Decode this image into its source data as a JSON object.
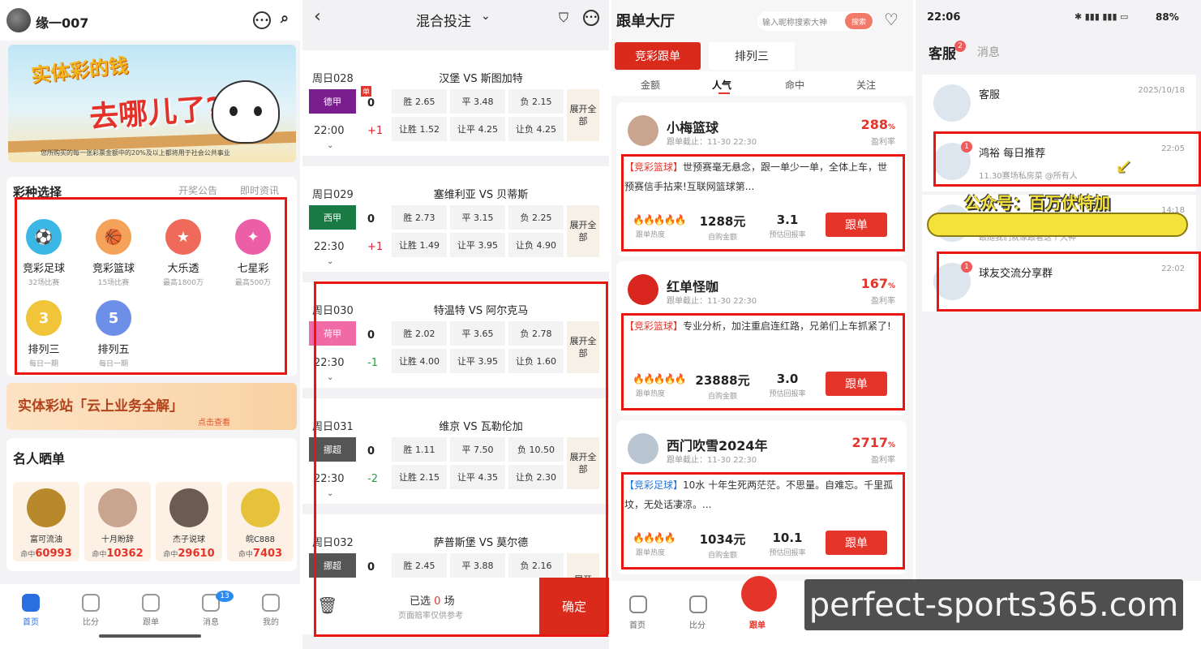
{
  "panel1": {
    "username": "缘一007",
    "banner": {
      "line1": "实体彩的钱",
      "line2": "去哪儿了?",
      "footnote": "您所购买的每一张彩票金额中的20%及以上都将用于社会公共事业"
    },
    "section_title": "彩种选择",
    "section_links": [
      "开奖公告",
      "即时资讯"
    ],
    "lotteries": [
      {
        "name": "竞彩足球",
        "sub": "32场比赛",
        "color": "#3bb7e6",
        "glyph": "⚽"
      },
      {
        "name": "竞彩篮球",
        "sub": "15场比赛",
        "color": "#f5a25a",
        "glyph": "🏀"
      },
      {
        "name": "大乐透",
        "sub": "最高1800万",
        "color": "#ef6a5a",
        "glyph": "★"
      },
      {
        "name": "七星彩",
        "sub": "最高500万",
        "color": "#ec5ea8",
        "glyph": "✦"
      },
      {
        "name": "排列三",
        "sub": "每日一期",
        "color": "#f1c43a",
        "glyph": "3"
      },
      {
        "name": "排列五",
        "sub": "每日一期",
        "color": "#6e8fe8",
        "glyph": "5"
      }
    ],
    "promo_title": "实体彩站「云上业务全解」",
    "promo_link": "点击查看",
    "celebs_title": "名人晒单",
    "celebs": [
      {
        "name": "富可流油",
        "hits_label": "命中",
        "hits": "60993",
        "color": "#b8892a"
      },
      {
        "name": "十月盼辞",
        "hits_label": "命中",
        "hits": "10362",
        "color": "#c9a48f"
      },
      {
        "name": "杰子说球",
        "hits_label": "命中",
        "hits": "29610",
        "color": "#6b5b52"
      },
      {
        "name": "皖C888",
        "hits_label": "命中",
        "hits": "7403",
        "color": "#e5c23a"
      }
    ],
    "tabs": [
      {
        "label": "首页",
        "active": true
      },
      {
        "label": "比分",
        "active": false
      },
      {
        "label": "跟单",
        "active": false
      },
      {
        "label": "消息",
        "active": false,
        "badge": "13"
      },
      {
        "label": "我的",
        "active": false
      }
    ]
  },
  "panel2": {
    "title": "混合投注",
    "matches": [
      {
        "day": "周日028",
        "home": "汉堡",
        "vs": "VS",
        "away": "斯图加特",
        "league": "德甲",
        "league_color": "#7a1d8e",
        "time": "22:00",
        "hc0": "0",
        "hc1": "+1",
        "row1": [
          "胜 2.65",
          "平 3.48",
          "负 2.15"
        ],
        "row2": [
          "让胜 1.52",
          "让平 4.25",
          "让负 4.25"
        ],
        "expand": "展开全部",
        "single": "单"
      },
      {
        "day": "周日029",
        "home": "塞维利亚",
        "vs": "VS",
        "away": "贝蒂斯",
        "league": "西甲",
        "league_color": "#1a7a44",
        "time": "22:30",
        "hc0": "0",
        "hc1": "+1",
        "row1": [
          "胜 2.73",
          "平 3.15",
          "负 2.25"
        ],
        "row2": [
          "让胜 1.49",
          "让平 3.95",
          "让负 4.90"
        ],
        "expand": "展开全部"
      },
      {
        "day": "周日030",
        "home": "特温特",
        "vs": "VS",
        "away": "阿尔克马",
        "league": "荷甲",
        "league_color": "#f06aa6",
        "time": "22:30",
        "hc0": "0",
        "hc1": "-1",
        "row1": [
          "胜 2.02",
          "平 3.65",
          "负 2.78"
        ],
        "row2": [
          "让胜 4.00",
          "让平 3.95",
          "让负 1.60"
        ],
        "expand": "展开全部"
      },
      {
        "day": "周日031",
        "home": "维京",
        "vs": "VS",
        "away": "瓦勒伦加",
        "league": "挪超",
        "league_color": "#555555",
        "time": "22:30",
        "hc0": "0",
        "hc1": "-2",
        "row1": [
          "胜 1.11",
          "平 7.50",
          "负 10.50"
        ],
        "row2": [
          "让胜 2.15",
          "让平 4.35",
          "让负 2.30"
        ],
        "expand": "展开全部"
      },
      {
        "day": "周日032",
        "home": "萨普斯堡",
        "vs": "VS",
        "away": "莫尔德",
        "league": "挪超",
        "league_color": "#555555",
        "time": "",
        "hc0": "0",
        "hc1": "",
        "row1": [
          "胜 2.45",
          "平 3.88",
          "负 2.16"
        ],
        "row2": [
          "",
          "",
          ""
        ],
        "expand": "展开"
      }
    ],
    "footer": {
      "selected_prefix": "已选",
      "selected_count": "0",
      "selected_suffix": "场",
      "note": "页面赔率仅供参考",
      "confirm": "确定"
    }
  },
  "panel3": {
    "title": "跟单大厅",
    "search_placeholder": "输入昵称搜索大神",
    "search_button": "搜索",
    "type_tabs": [
      "竞彩跟单",
      "排列三"
    ],
    "sort_tabs": [
      "金额",
      "人气",
      "命中",
      "关注"
    ],
    "records": [
      {
        "name": "小梅篮球",
        "deadline": "跟单截止：11-30 22:30",
        "rate": "288",
        "rate_unit": "%",
        "rate_label": "盈利率",
        "tag": "【竞彩篮球】",
        "tag_color": "red",
        "text": "世预赛毫无悬念，跟一单少一单，全体上车，世预赛信手拈来!互联网篮球第...",
        "flames": "🔥🔥🔥🔥🔥",
        "heat_label": "跟单热度",
        "amount": "1288元",
        "amount_label": "自购金额",
        "return": "3.1",
        "return_label": "预估回报率",
        "follow": "跟单",
        "avatar_color": "#c9a48f"
      },
      {
        "name": "红单怪咖",
        "deadline": "跟单截止：11-30 22:30",
        "rate": "167",
        "rate_unit": "%",
        "rate_label": "盈利率",
        "tag": "【竞彩篮球】",
        "tag_color": "red",
        "text": "专业分析，加注重启连红路，兄弟们上车抓紧了!",
        "flames": "🔥🔥🔥🔥🔥",
        "heat_label": "跟单热度",
        "amount": "23888元",
        "amount_label": "自购金额",
        "return": "3.0",
        "return_label": "预估回报率",
        "follow": "跟单",
        "avatar_color": "#d8261e"
      },
      {
        "name": "西门吹雪2024年",
        "deadline": "跟单截止：11-30 22:30",
        "rate": "2717",
        "rate_unit": "%",
        "rate_label": "盈利率",
        "tag": "【竞彩足球】",
        "tag_color": "blue",
        "text": "10水 十年生死两茫茫。不思量。自难忘。千里孤坟，无处话凄凉。...",
        "flames": "🔥🔥🔥🔥",
        "heat_label": "跟单热度",
        "amount": "1034元",
        "amount_label": "自购金额",
        "return": "10.1",
        "return_label": "预估回报率",
        "follow": "跟单",
        "avatar_color": "#b9c6d2"
      }
    ],
    "tabs": [
      "首页",
      "比分",
      "跟单"
    ]
  },
  "panel4": {
    "status_time": "22:06",
    "status_right": "88%",
    "tab_service": "客服",
    "tab_service_badge": "2",
    "tab_message": "消息",
    "chats": [
      {
        "name": "客服",
        "time": "2025/10/18",
        "sub": "",
        "badge": ""
      },
      {
        "name": "鸿裕 每日推荐",
        "time": "22:05",
        "sub": "11.30赛场私房菜 @所有人",
        "badge": "1"
      },
      {
        "name": "",
        "time": "14:18",
        "sub": "跟随我们就像跟着这个大神",
        "badge": ""
      },
      {
        "name": "球友交流分享群",
        "time": "22:02",
        "sub": "",
        "badge": "1"
      }
    ],
    "overlay_text": "公众号：百万伏特加"
  },
  "watermark": "perfect-sports365.com"
}
